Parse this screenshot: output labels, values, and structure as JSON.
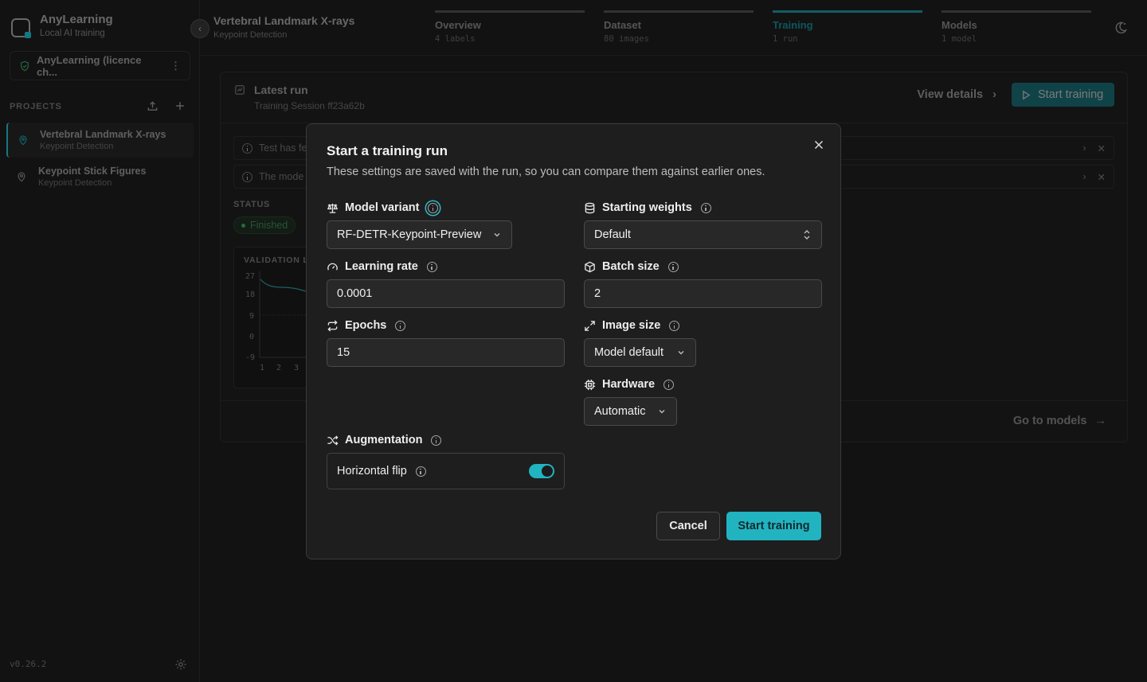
{
  "sidebar": {
    "app_name": "AnyLearning",
    "app_subtitle": "Local AI training",
    "licence_label": "AnyLearning (licence ch...",
    "projects_heading": "PROJECTS",
    "projects": [
      {
        "title": "Vertebral Landmark X-rays",
        "subtitle": "Keypoint Detection",
        "active": true
      },
      {
        "title": "Keypoint Stick Figures",
        "subtitle": "Keypoint Detection",
        "active": false
      }
    ],
    "version": "v0.26.2"
  },
  "header": {
    "project_title": "Vertebral Landmark X-rays",
    "project_subtitle": "Keypoint Detection",
    "steps": [
      {
        "label": "Overview",
        "sub": "4 labels"
      },
      {
        "label": "Dataset",
        "sub": "80 images"
      },
      {
        "label": "Training",
        "sub": "1 run",
        "active": true
      },
      {
        "label": "Models",
        "sub": "1 model"
      }
    ]
  },
  "run_card": {
    "title": "Latest run",
    "subtitle": "Training Session ff23a62b",
    "view_details": "View details",
    "start_training": "Start training",
    "alerts": [
      "Test has fe",
      "The mode"
    ],
    "status_label": "STATUS",
    "status_value": "Finished",
    "chart_title": "VALIDATION L",
    "chart_y_ticks": [
      "27",
      "18",
      "9",
      "0",
      "-9"
    ],
    "chart_x_ticks": [
      "1",
      "2",
      "3"
    ],
    "go_to_models": "Go to models"
  },
  "modal": {
    "title": "Start a training run",
    "subtitle": "These settings are saved with the run, so you can compare them against earlier ones.",
    "model_variant": {
      "label": "Model variant",
      "value": "RF-DETR-Keypoint-Preview"
    },
    "starting_weights": {
      "label": "Starting weights",
      "value": "Default"
    },
    "learning_rate": {
      "label": "Learning rate",
      "value": "0.0001"
    },
    "batch_size": {
      "label": "Batch size",
      "value": "2"
    },
    "epochs": {
      "label": "Epochs",
      "value": "15"
    },
    "image_size": {
      "label": "Image size",
      "value": "Model default"
    },
    "hardware": {
      "label": "Hardware",
      "value": "Automatic"
    },
    "augmentation": {
      "label": "Augmentation",
      "horizontal_flip_label": "Horizontal flip",
      "horizontal_flip_enabled": true
    },
    "cancel": "Cancel",
    "start": "Start training"
  },
  "colors": {
    "accent": "#22b3c0",
    "background": "#1b1b1c",
    "modal_bg": "#1e1e1f",
    "status_green": "#3f9d55"
  }
}
